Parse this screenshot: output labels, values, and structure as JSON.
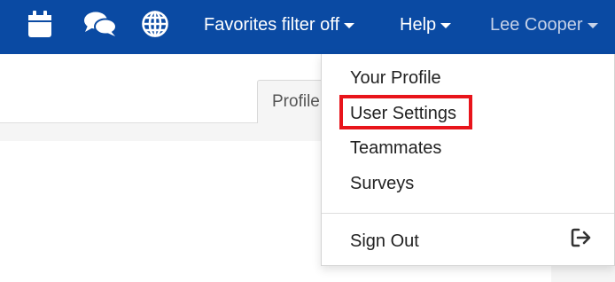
{
  "topbar": {
    "icons": [
      "calendar-icon",
      "chat-icon",
      "globe-icon"
    ],
    "favorites_label": "Favorites filter off",
    "help_label": "Help",
    "user_label": "Lee Cooper"
  },
  "main": {
    "tab_label": "Profile"
  },
  "dropdown": {
    "items": [
      {
        "label": "Your Profile"
      },
      {
        "label": "User Settings"
      },
      {
        "label": "Teammates"
      },
      {
        "label": "Surveys"
      }
    ],
    "signout_label": "Sign Out",
    "signout_icon": "sign-out-icon"
  },
  "colors": {
    "topbar": "#0a4aa3",
    "highlight": "#e8141b"
  }
}
